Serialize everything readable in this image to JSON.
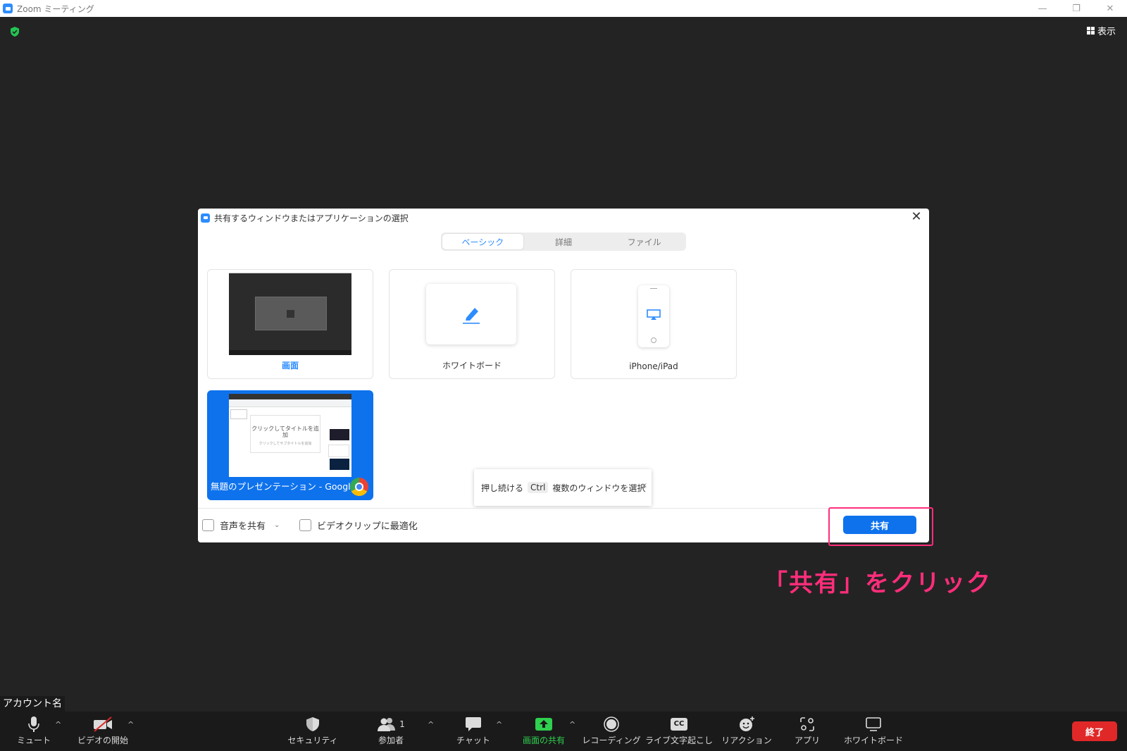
{
  "window": {
    "title": "Zoom ミーティング",
    "view_label": "表示"
  },
  "dialog": {
    "title": "共有するウィンドウまたはアプリケーションの選択",
    "tabs": [
      {
        "label": "ベーシック"
      },
      {
        "label": "詳細"
      },
      {
        "label": "ファイル"
      }
    ],
    "items": [
      {
        "label": "画面"
      },
      {
        "label": "ホワイトボード"
      },
      {
        "label": "iPhone/iPad"
      },
      {
        "label": "無題のプレゼンテーション - Google ..."
      }
    ],
    "thumb_slide_title": "クリックしてタイトルを追加",
    "thumb_slide_sub": "クリックしてサブタイトルを追加",
    "tip": {
      "prefix": "押し続ける",
      "key": "Ctrl",
      "suffix": "複数のウィンドウを選択",
      "close": "×"
    },
    "share_audio_label": "音声を共有",
    "optimize_label": "ビデオクリップに最適化",
    "share_button": "共有"
  },
  "annotation": "「共有」をクリック",
  "account_name": "アカウント名",
  "toolbar": {
    "mute": "ミュート",
    "video": "ビデオの開始",
    "security": "セキュリティ",
    "participants": "参加者",
    "participants_count": "1",
    "chat": "チャット",
    "share_screen": "画面の共有",
    "recording": "レコーディング",
    "captions": "ライブ文字起こし",
    "captions_icon_text": "CC",
    "reactions": "リアクション",
    "apps": "アプリ",
    "whiteboard": "ホワイトボード",
    "end": "終了"
  },
  "colors": {
    "accent": "#0e72ed",
    "highlight": "#ff2d7a",
    "end": "#e02828",
    "share_green": "#2fd04e"
  }
}
